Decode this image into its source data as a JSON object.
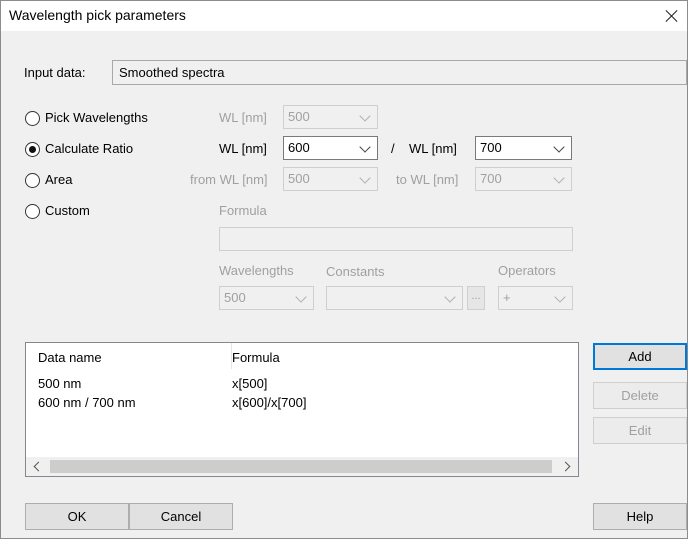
{
  "window": {
    "title": "Wavelength pick parameters"
  },
  "input_data": {
    "label": "Input data:",
    "value": "Smoothed spectra"
  },
  "modes": {
    "pick": {
      "label": "Pick Wavelengths",
      "checked": false,
      "wl_label": "WL [nm]",
      "wl_value": "500"
    },
    "ratio": {
      "label": "Calculate Ratio",
      "checked": true,
      "wl1_label": "WL [nm]",
      "wl1_value": "600",
      "divider": "/",
      "wl2_label": "WL [nm]",
      "wl2_value": "700"
    },
    "area": {
      "label": "Area",
      "checked": false,
      "from_label": "from WL [nm]",
      "from_value": "500",
      "to_label": "to WL [nm]",
      "to_value": "700"
    },
    "custom": {
      "label": "Custom",
      "checked": false,
      "formula_label": "Formula",
      "formula_value": "",
      "wavelengths_label": "Wavelengths",
      "wavelengths_value": "500",
      "constants_label": "Constants",
      "constants_value": "",
      "constants_button": "...",
      "operators_label": "Operators",
      "operators_value": "+"
    }
  },
  "table": {
    "columns": [
      "Data name",
      "Formula"
    ],
    "rows": [
      {
        "name": "500 nm",
        "formula": "x[500]"
      },
      {
        "name": "600 nm / 700 nm",
        "formula": "x[600]/x[700]"
      }
    ]
  },
  "buttons": {
    "add": "Add",
    "delete": "Delete",
    "edit": "Edit",
    "ok": "OK",
    "cancel": "Cancel",
    "help": "Help"
  }
}
